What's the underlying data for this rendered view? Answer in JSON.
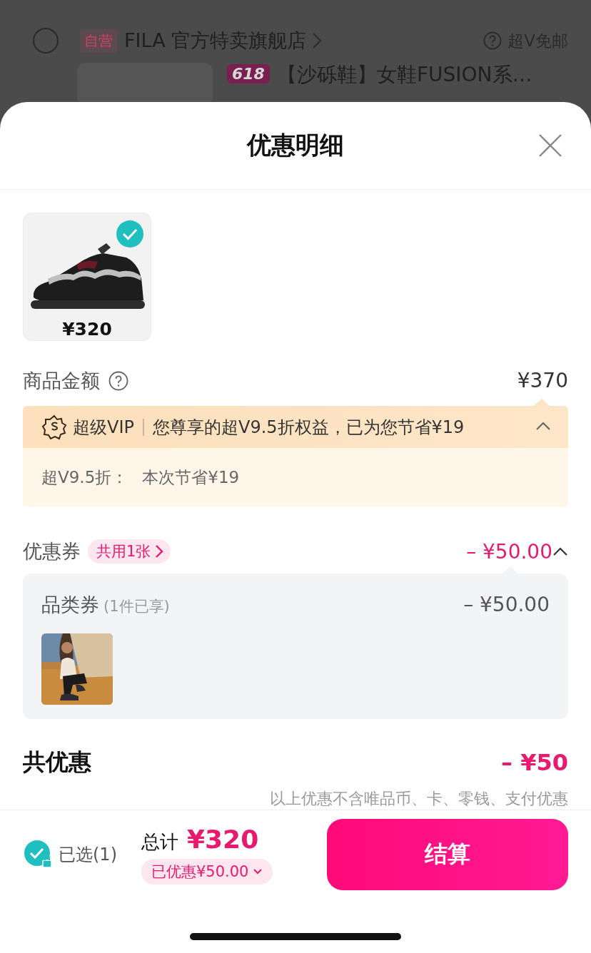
{
  "background": {
    "store": {
      "selected": false,
      "tag": "自营",
      "name": "FILA 官方特卖旗舰店",
      "shipping": "超V免邮"
    },
    "product": {
      "badge": "618",
      "title": "【沙砾鞋】女鞋FUSION系…"
    }
  },
  "sheet": {
    "title": "优惠明细"
  },
  "items": [
    {
      "price": "¥320",
      "selected": true
    }
  ],
  "goods_amount": {
    "label": "商品金额",
    "value": "¥370"
  },
  "vip": {
    "brand": "超级VIP",
    "message": "您尊享的超V9.5折权益，已为您节省¥19",
    "expanded": true,
    "details": [
      {
        "label": "超V9.5折：",
        "value": "本次节省¥19"
      }
    ]
  },
  "coupons": {
    "label": "优惠券",
    "tag": "共用1张",
    "value": "– ¥50.00",
    "expanded": true,
    "items": [
      {
        "name": "品类券",
        "note": "(1件已享)",
        "value": "– ¥50.00"
      }
    ]
  },
  "total_discount": {
    "label": "共优惠",
    "value": "– ¥50",
    "note": "以上优惠不含唯品币、卡、零钱、支付优惠"
  },
  "footer": {
    "all_selected": true,
    "selected_label": "已选(1)",
    "total_label": "总计",
    "total": "¥320",
    "saved": "已优惠¥50.00",
    "checkout": "结算"
  }
}
